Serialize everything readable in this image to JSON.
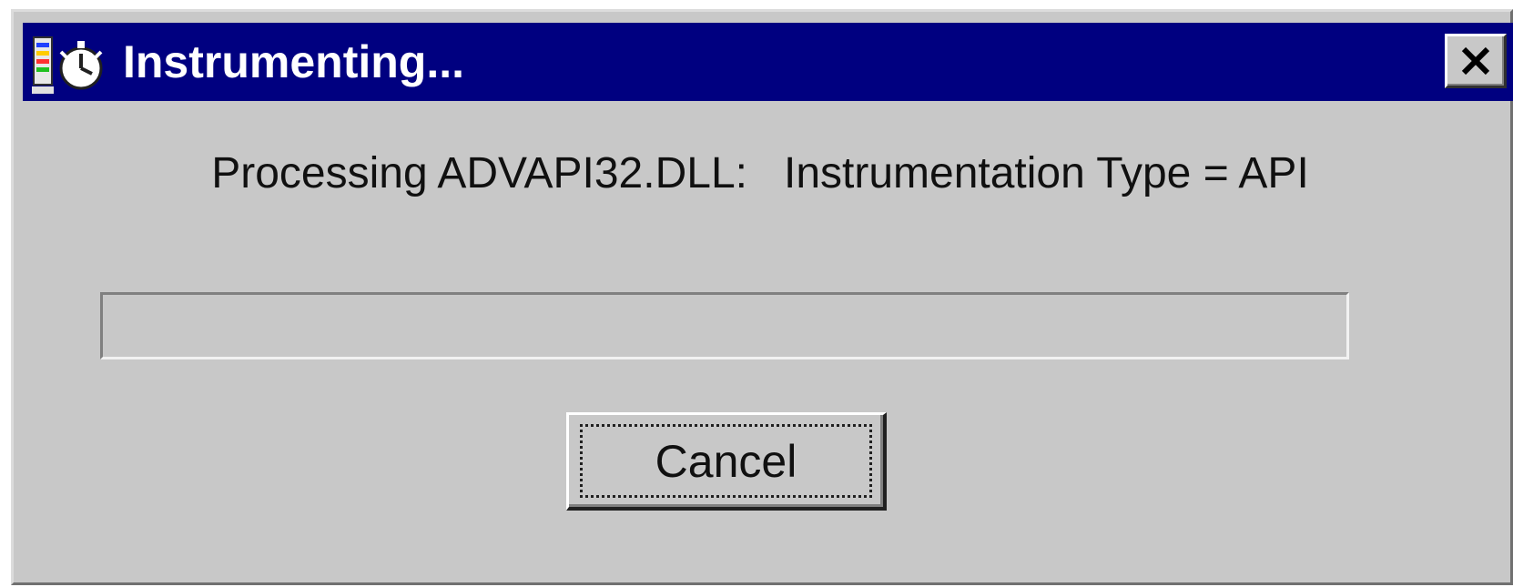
{
  "window": {
    "title": "Instrumenting...",
    "icon": "instrumentation-stopwatch-icon",
    "close_icon": "close-x-icon"
  },
  "status": {
    "message": "Processing ADVAPI32.DLL:   Instrumentation Type = API"
  },
  "progress": {
    "fraction": 0
  },
  "buttons": {
    "cancel_label": "Cancel"
  },
  "colors": {
    "titlebar": "#000080",
    "face": "#c8c8c8",
    "title_text": "#ffffff"
  }
}
